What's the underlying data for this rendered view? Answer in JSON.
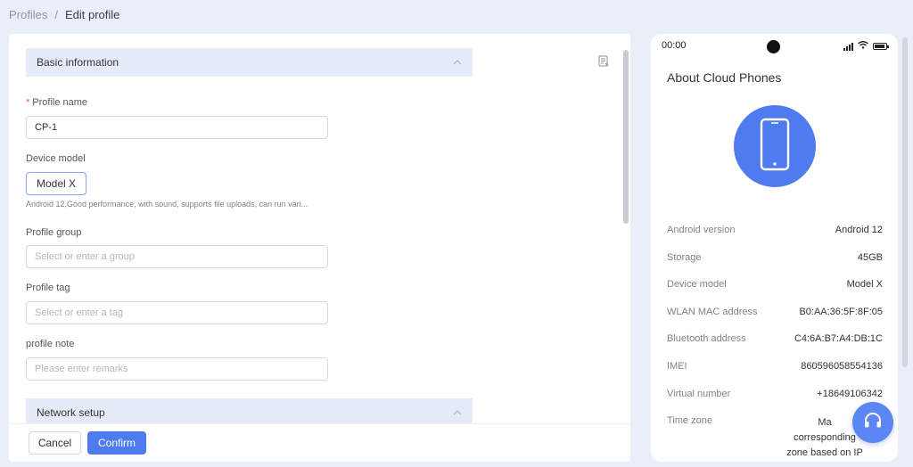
{
  "breadcrumb": {
    "parent": "Profiles",
    "separator": "/",
    "current": "Edit profile"
  },
  "sections": {
    "basic": "Basic information",
    "network": "Network setup"
  },
  "form": {
    "profile_name_label": "Profile name",
    "profile_name_value": "CP-1",
    "device_model_label": "Device model",
    "device_model_value": "Model X",
    "device_model_desc": "Android 12,Good performance, with sound, supports file uploads, can run vari...",
    "profile_group_label": "Profile group",
    "profile_group_placeholder": "Select or enter a group",
    "profile_tag_label": "Profile tag",
    "profile_tag_placeholder": "Select or enter a tag",
    "profile_note_label": "profile note",
    "profile_note_placeholder": "Please enter remarks"
  },
  "footer": {
    "cancel": "Cancel",
    "confirm": "Confirm"
  },
  "phone": {
    "status_time": "00:00",
    "title": "About Cloud Phones",
    "specs": [
      {
        "label": "Android version",
        "value": "Android 12"
      },
      {
        "label": "Storage",
        "value": "45GB"
      },
      {
        "label": "Device model",
        "value": "Model X"
      },
      {
        "label": "WLAN MAC address",
        "value": "B0:AA:36:5F:8F:05"
      },
      {
        "label": "Bluetooth address",
        "value": "C4:6A:B7:A4:DB:1C"
      },
      {
        "label": "IMEI",
        "value": "860596058554136"
      },
      {
        "label": "Virtual number",
        "value": "+18649106342"
      },
      {
        "label": "Time zone",
        "value_line1": "Ma",
        "value_line2": "corresponding",
        "value_line3": "zone based on IP"
      }
    ]
  },
  "colors": {
    "accent": "#4f7bf0",
    "section_bg": "#e5ebf8",
    "page_bg": "#e9eef9",
    "required": "#f05a5a"
  },
  "icons": [
    "doc-edit-icon",
    "chevron-up-icon",
    "phone-icon",
    "signal-icon",
    "wifi-icon",
    "battery-icon",
    "headset-icon"
  ]
}
